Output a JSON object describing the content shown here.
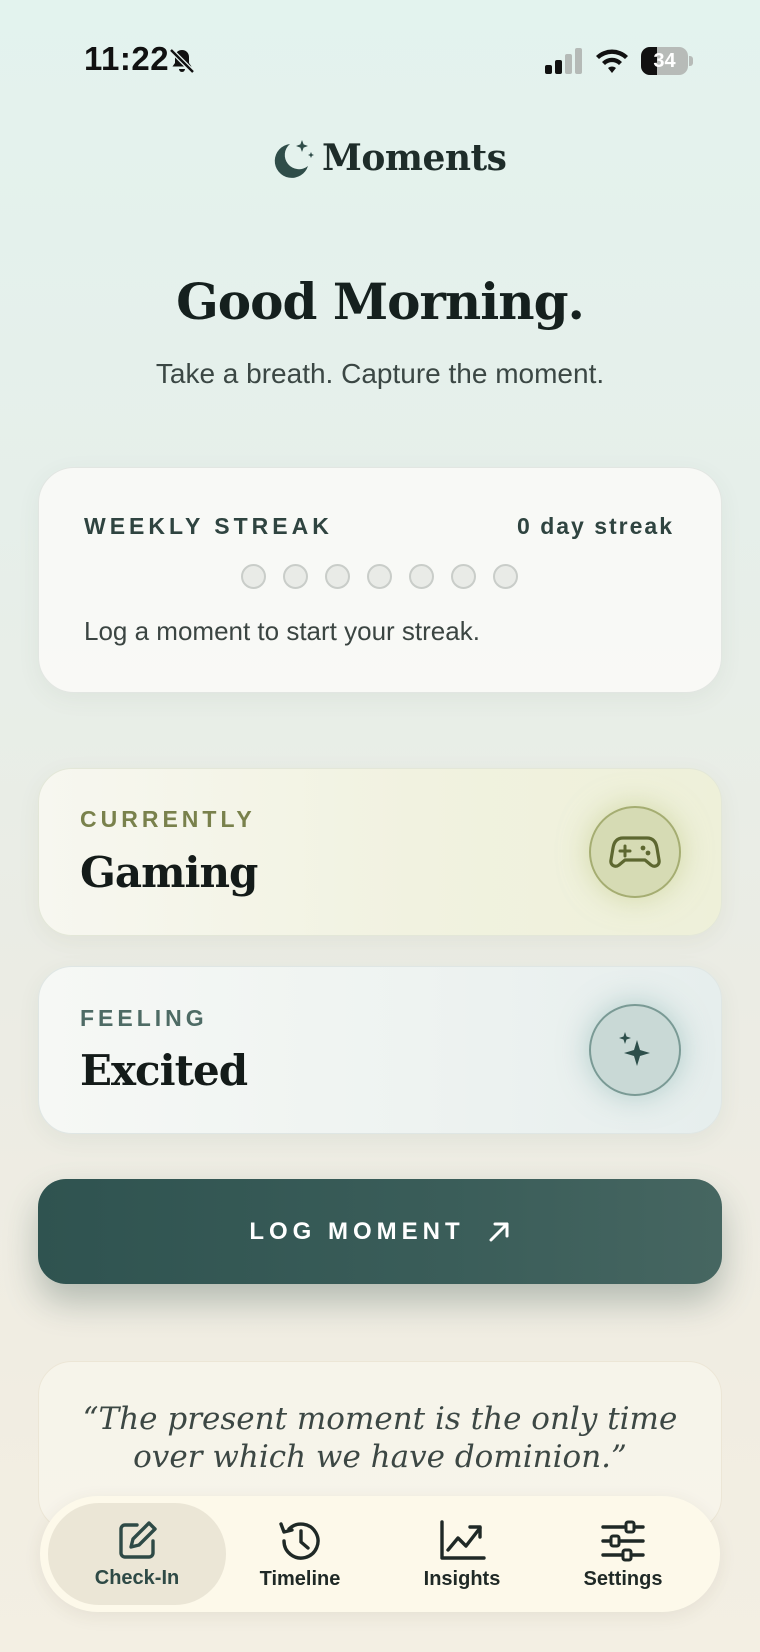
{
  "status_bar": {
    "time": "11:22",
    "battery_level": "34"
  },
  "app": {
    "title": "Moments"
  },
  "greeting": {
    "title": "Good Morning.",
    "subtitle": "Take a breath. Capture the moment."
  },
  "streak": {
    "label": "WEEKLY STREAK",
    "count_text": "0 day streak",
    "days_logged": 0,
    "days_total": 7,
    "hint": "Log a moment to start your streak."
  },
  "currently": {
    "label": "CURRENTLY",
    "value": "Gaming",
    "icon": "gamepad-icon"
  },
  "feeling": {
    "label": "FEELING",
    "value": "Excited",
    "icon": "sparkle-icon"
  },
  "log_button": {
    "label": "LOG MOMENT",
    "icon": "arrow-up-right-icon"
  },
  "quote": {
    "text": "“The present moment is the only time over which we have dominion.”"
  },
  "tabs": [
    {
      "label": "Check-In",
      "icon": "edit-square-icon",
      "active": true
    },
    {
      "label": "Timeline",
      "icon": "history-clock-icon",
      "active": false
    },
    {
      "label": "Insights",
      "icon": "trend-chart-icon",
      "active": false
    },
    {
      "label": "Settings",
      "icon": "sliders-icon",
      "active": false
    }
  ],
  "colors": {
    "accent": "#2f5350",
    "currently_accent": "#79814c",
    "feeling_accent": "#4e6b65",
    "background_top": "#e3f3ee",
    "background_bottom": "#f3efe3"
  }
}
